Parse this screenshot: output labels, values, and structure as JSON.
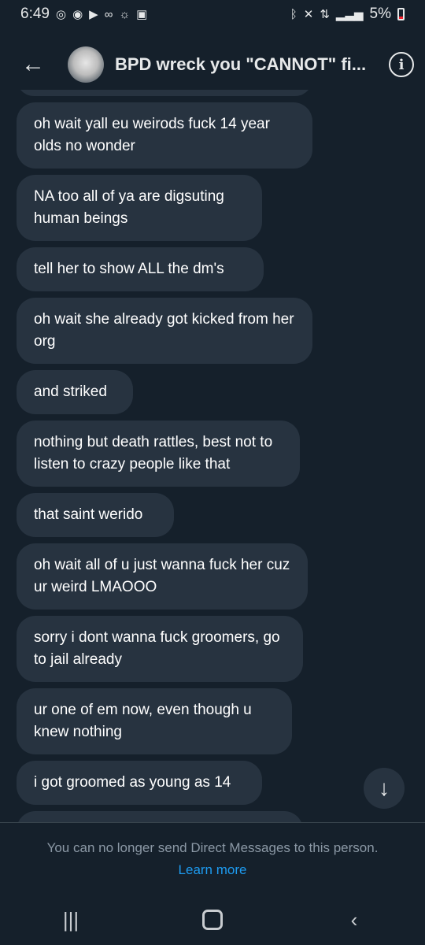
{
  "status_bar": {
    "time": "6:49",
    "battery": "5%",
    "left_icons": [
      "whatsapp-icon",
      "discord-icon",
      "youtube-icon",
      "voicemail-icon",
      "weather-icon",
      "gallery-icon"
    ],
    "right_icons": [
      "bluetooth-icon",
      "mute-icon",
      "data-icon",
      "signal-icon",
      "battery-icon"
    ],
    "battery_color": "#f4212e"
  },
  "header": {
    "title": "BPD wreck you \"CANNOT\" fi...",
    "back_icon": "arrow-left-icon",
    "info_icon": "info-icon"
  },
  "messages": [
    "oh wait yall eu weirods fuck 14 year olds no wonder",
    "NA too all of ya are digsuting human beings",
    "tell her to show ALL the dm's",
    "oh wait she already got kicked from her org",
    "and striked",
    "nothing but death rattles, best not to listen to crazy people like that",
    "that saint werido",
    "oh wait all of u just wanna fuck her cuz ur weird LMAOOO",
    "sorry i dont wanna fuck groomers, go to jail already",
    "ur one of em now, even though u knew nothing",
    "i got groomed as young as 14"
  ],
  "footer": {
    "note": "You can no longer send Direct Messages to this person.",
    "link": "Learn more"
  },
  "colors": {
    "background": "#15202b",
    "bubble": "#273340",
    "link": "#1d9bf0",
    "muted_text": "#8b98a5"
  }
}
